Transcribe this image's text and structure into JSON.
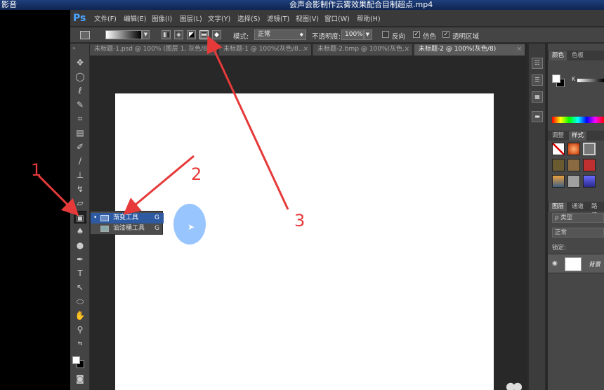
{
  "player": {
    "name_partial": "影音",
    "title_partial": "会声会影制作云雾效果配合目制超点.mp4"
  },
  "menu": {
    "logo": "Ps",
    "items": [
      "文件(F)",
      "编辑(E)",
      "图像(I)",
      "图层(L)",
      "文字(Y)",
      "选择(S)",
      "滤镜(T)",
      "视图(V)",
      "窗口(W)",
      "帮助(H)"
    ]
  },
  "options": {
    "mode_label": "模式:",
    "mode_value": "正常",
    "opacity_label": "不透明度:",
    "opacity_value": "100%",
    "reverse_label": "反向",
    "dither_label": "仿色",
    "transparency_label": "透明区域"
  },
  "tabs": [
    {
      "label": "未标题-1.psd @ 100% (图层 1, 灰色/8...",
      "active": false
    },
    {
      "label": "未标题-1 @ 100%(灰色/8...",
      "active": false
    },
    {
      "label": "未标题-2.bmp @ 100%(灰色...",
      "active": false
    },
    {
      "label": "未标题-2 @ 100%(灰色/8)",
      "active": true
    }
  ],
  "flyout": {
    "items": [
      {
        "label": "渐变工具",
        "key": "G",
        "selected": true
      },
      {
        "label": "油漆桶工具",
        "key": "G",
        "selected": false
      }
    ]
  },
  "panels": {
    "color_tabs": [
      "颜色",
      "色板"
    ],
    "k_label": "K",
    "style_tabs": [
      "调整",
      "样式"
    ],
    "layer_tabs": [
      "图层",
      "通道",
      "路径"
    ],
    "kind_label": "ρ 类型",
    "blend_value": "正常",
    "lock_label": "锁定:",
    "layer_name": "背景"
  },
  "annotations": [
    "1",
    "2",
    "3"
  ],
  "colors": {
    "arrow": "#e63a3a",
    "highlight_circle": "#4696ff",
    "ps_logo": "#4aa3ff"
  }
}
